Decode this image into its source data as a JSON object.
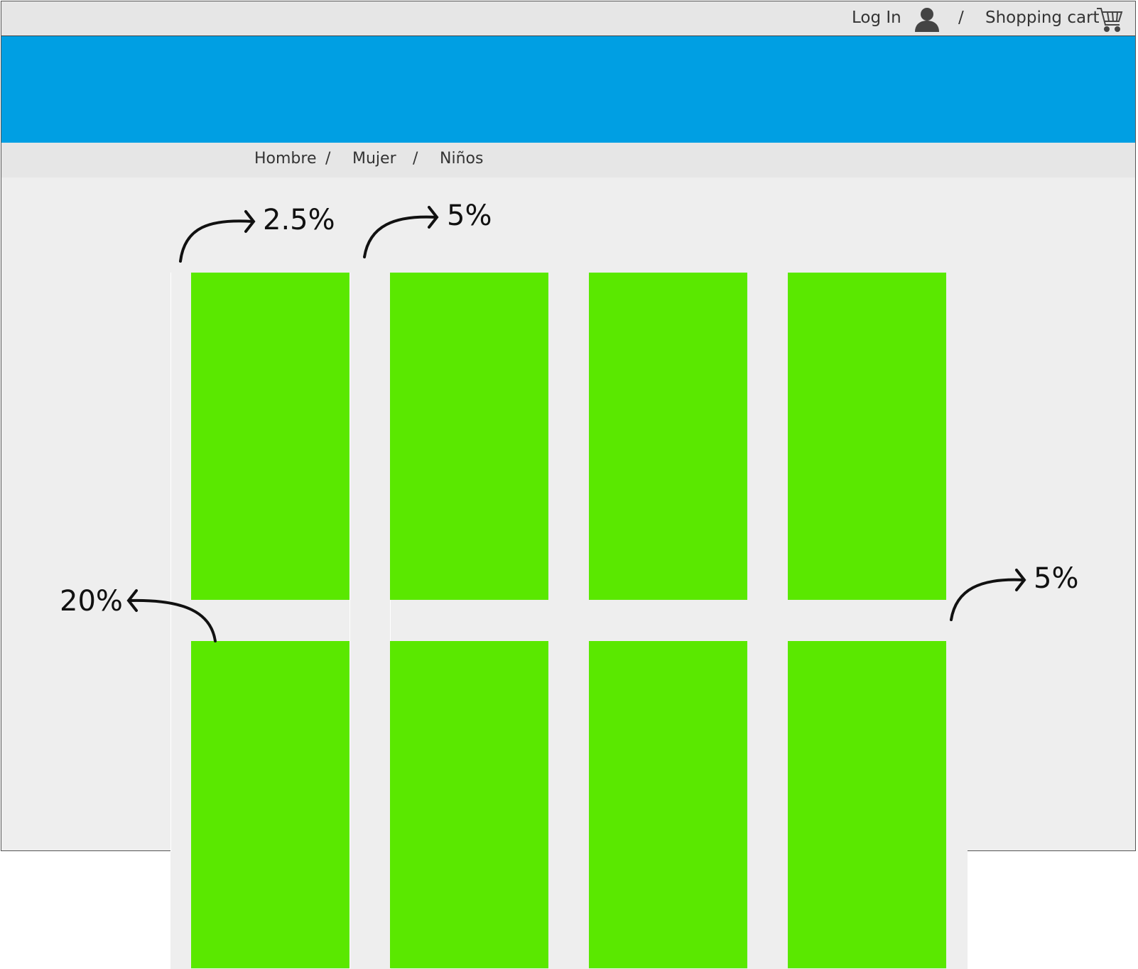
{
  "topbar": {
    "login_label": "Log In",
    "separator": "/",
    "cart_label": "Shopping cart",
    "user_icon": "user-icon",
    "cart_icon": "cart-icon"
  },
  "nav": {
    "items": [
      {
        "label": "Hombre"
      },
      {
        "label": "Mujer"
      },
      {
        "label": "Niños"
      }
    ],
    "separator": "/"
  },
  "annotations": {
    "left_margin": "2.5%",
    "gutter": "5%",
    "row_offset": "20%",
    "right_margin": "5%"
  },
  "colors": {
    "banner": "#009fe3",
    "tile": "#5ae800",
    "bar": "#e6e6e6",
    "page": "#eeeeee"
  }
}
